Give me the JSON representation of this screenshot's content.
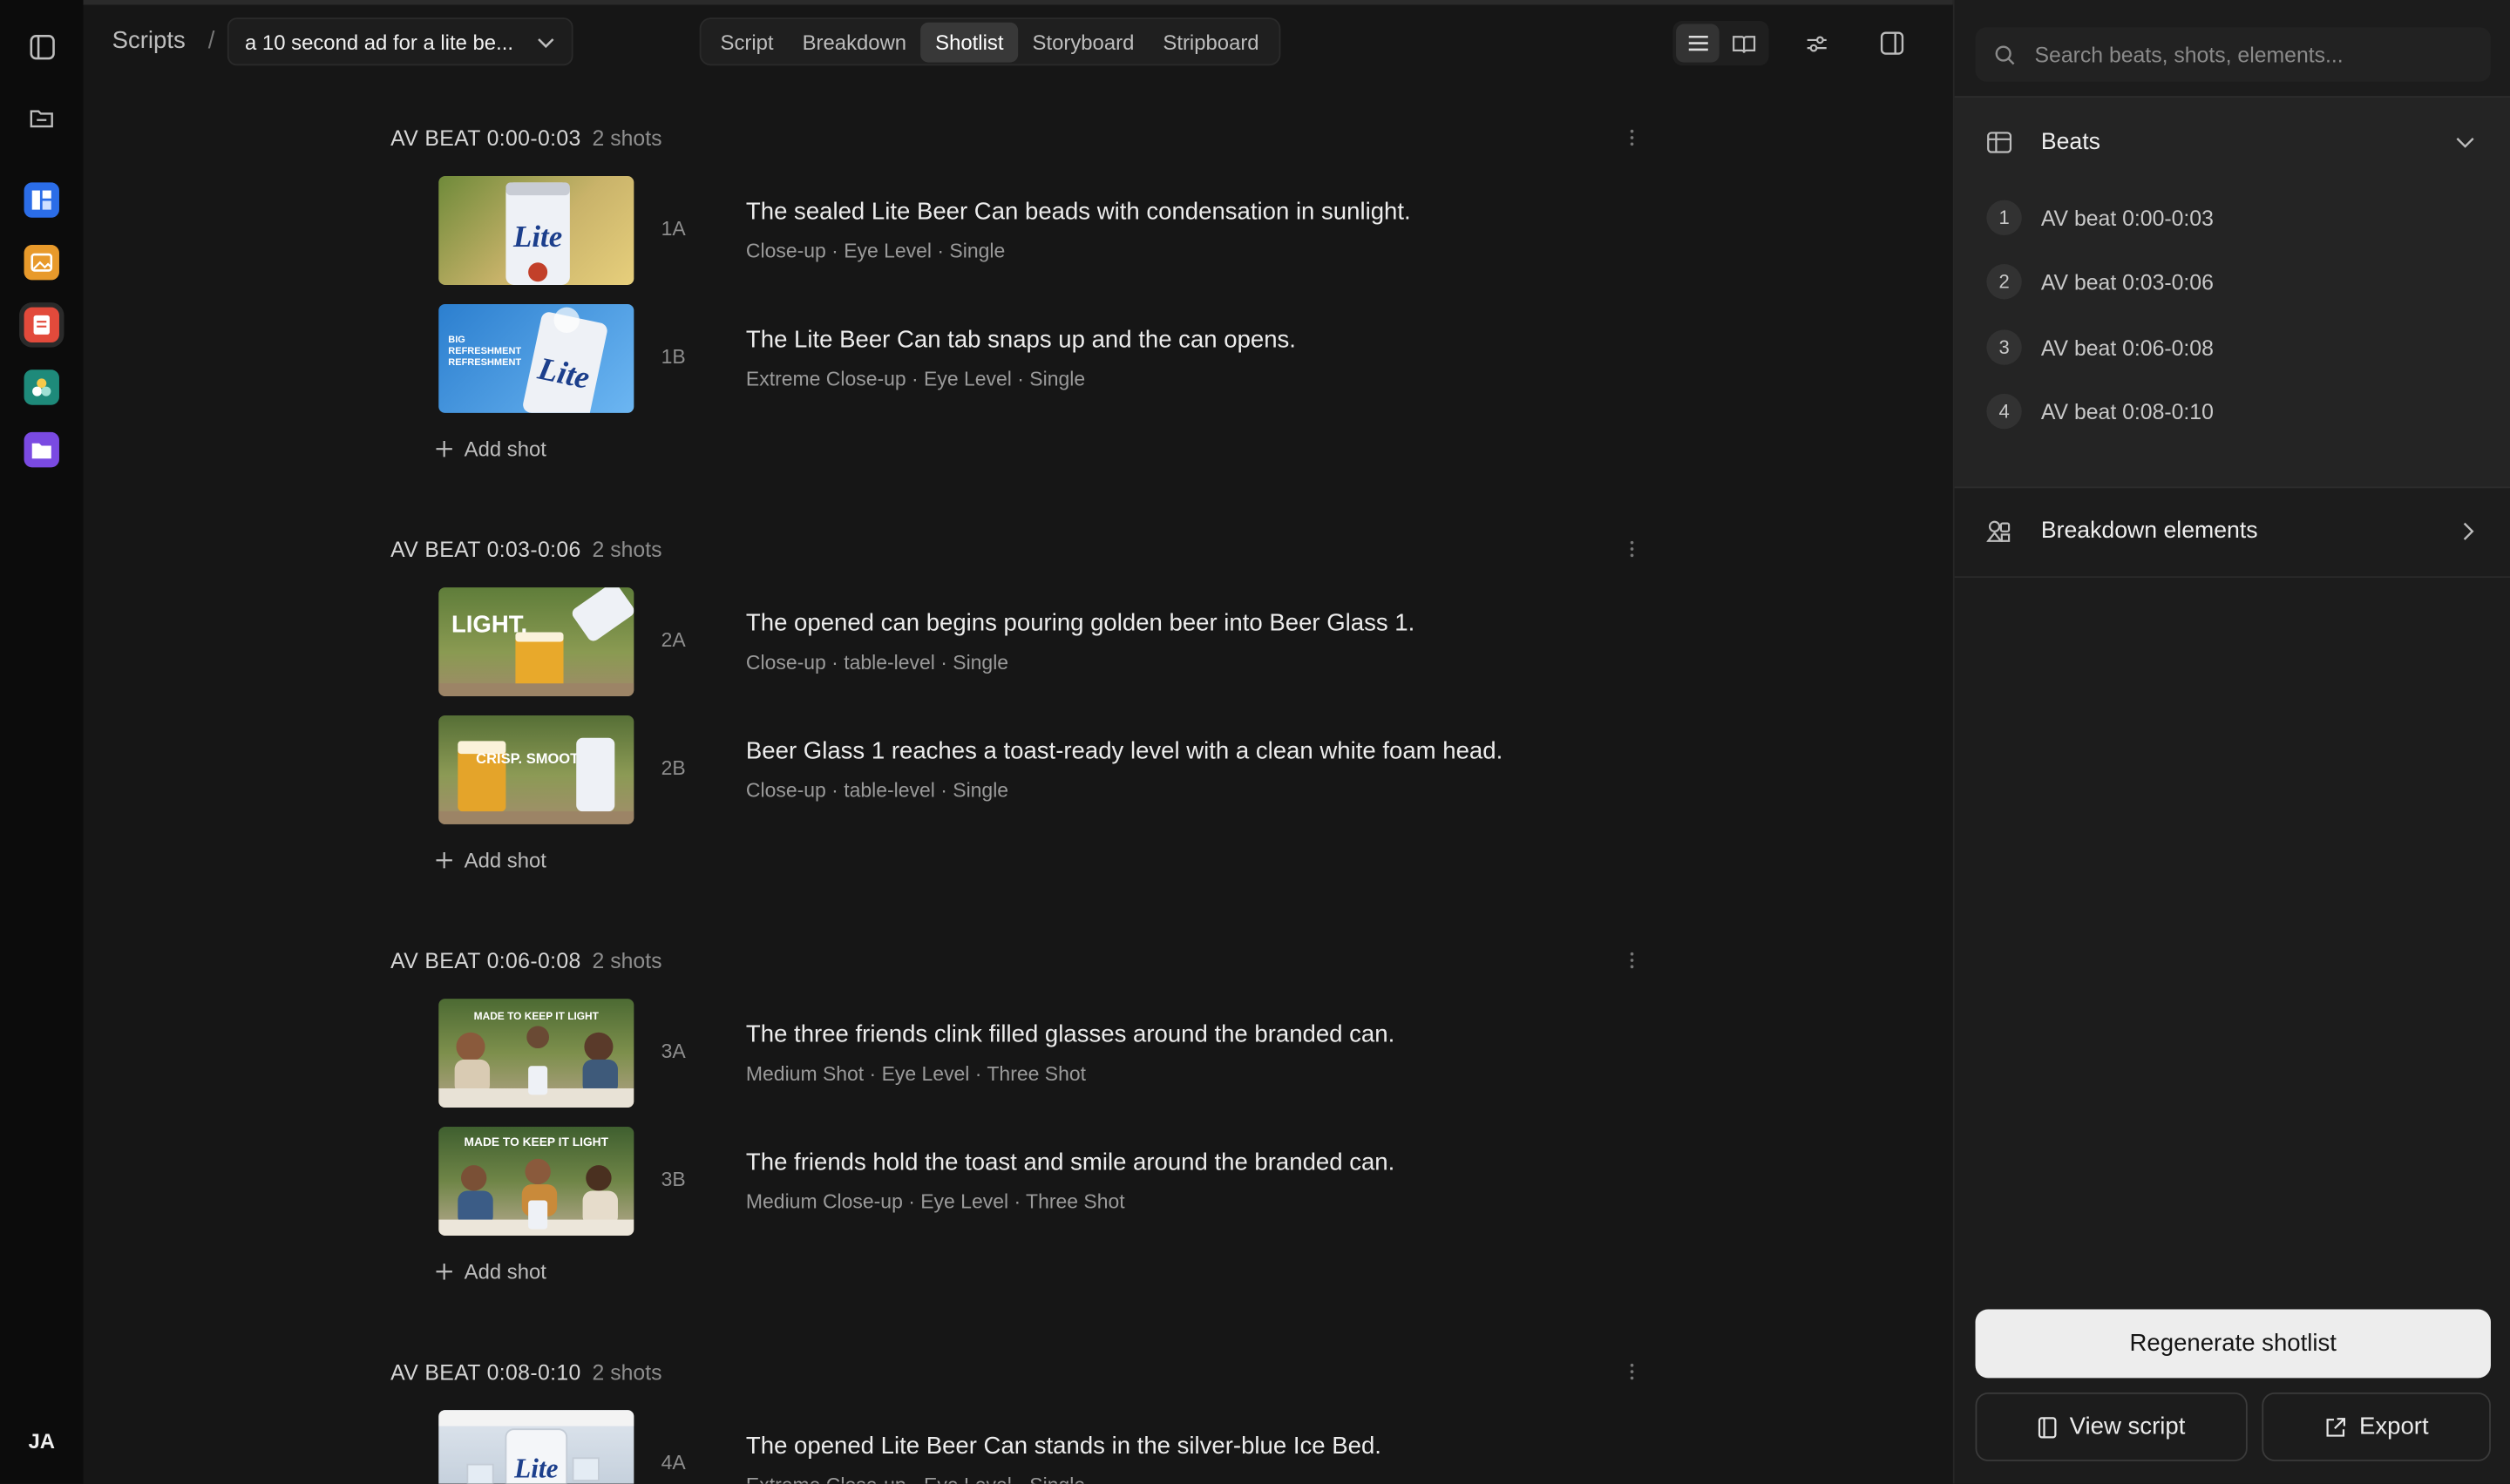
{
  "app": {
    "avatar_initials": "JA",
    "rail_apps": [
      {
        "name": "boards",
        "color": "#2b6de8"
      },
      {
        "name": "images",
        "color": "#e89a2b"
      },
      {
        "name": "scripts",
        "color": "#e24a3b"
      },
      {
        "name": "elements",
        "color": "#1e8a7a"
      },
      {
        "name": "files",
        "color": "#7a4ae2"
      }
    ]
  },
  "header": {
    "breadcrumb_root": "Scripts",
    "breadcrumb_sep": "/",
    "script_title": "a 10 second ad for a lite be...",
    "tabs": [
      {
        "label": "Script",
        "active": false
      },
      {
        "label": "Breakdown",
        "active": false
      },
      {
        "label": "Shotlist",
        "active": true
      },
      {
        "label": "Storyboard",
        "active": false
      },
      {
        "label": "Stripboard",
        "active": false
      }
    ]
  },
  "shotlist": {
    "add_shot_label": "Add shot",
    "beats": [
      {
        "title": "AV BEAT 0:00-0:03",
        "count": "2 shots",
        "shots": [
          {
            "id": "1A",
            "title": "The sealed Lite Beer Can beads with condensation in sunlight.",
            "meta": "Close-up · Eye Level · Single",
            "thumb_text": "Lite"
          },
          {
            "id": "1B",
            "title": "The Lite Beer Can tab snaps up and the can opens.",
            "meta": "Extreme Close-up · Eye Level · Single",
            "thumb_text": "Lite"
          }
        ]
      },
      {
        "title": "AV BEAT 0:03-0:06",
        "count": "2 shots",
        "shots": [
          {
            "id": "2A",
            "title": "The opened can begins pouring golden beer into Beer Glass 1.",
            "meta": "Close-up · table-level · Single",
            "thumb_text": "LIGHT."
          },
          {
            "id": "2B",
            "title": "Beer Glass 1 reaches a toast-ready level with a clean white foam head.",
            "meta": "Close-up · table-level · Single",
            "thumb_text": "CRISP. SMOOTH."
          }
        ]
      },
      {
        "title": "AV BEAT 0:06-0:08",
        "count": "2 shots",
        "shots": [
          {
            "id": "3A",
            "title": "The three friends clink filled glasses around the branded can.",
            "meta": "Medium Shot · Eye Level · Three Shot",
            "thumb_text": "MADE TO KEEP IT LIGHT"
          },
          {
            "id": "3B",
            "title": "The friends hold the toast and smile around the branded can.",
            "meta": "Medium Close-up · Eye Level · Three Shot",
            "thumb_text": "MADE TO KEEP IT LIGHT"
          }
        ]
      },
      {
        "title": "AV BEAT 0:08-0:10",
        "count": "2 shots",
        "shots": [
          {
            "id": "4A",
            "title": "The opened Lite Beer Can stands in the silver-blue Ice Bed.",
            "meta": "Extreme Close-up · Eye Level · Single",
            "thumb_text": "Lite"
          }
        ]
      }
    ]
  },
  "panel": {
    "search_placeholder": "Search beats, shots, elements...",
    "beats_label": "Beats",
    "beat_items": [
      {
        "num": "1",
        "label": "AV beat 0:00-0:03"
      },
      {
        "num": "2",
        "label": "AV beat 0:03-0:06"
      },
      {
        "num": "3",
        "label": "AV beat 0:06-0:08"
      },
      {
        "num": "4",
        "label": "AV beat 0:08-0:10"
      }
    ],
    "breakdown_label": "Breakdown elements",
    "regenerate_label": "Regenerate shotlist",
    "view_script_label": "View script",
    "export_label": "Export"
  }
}
